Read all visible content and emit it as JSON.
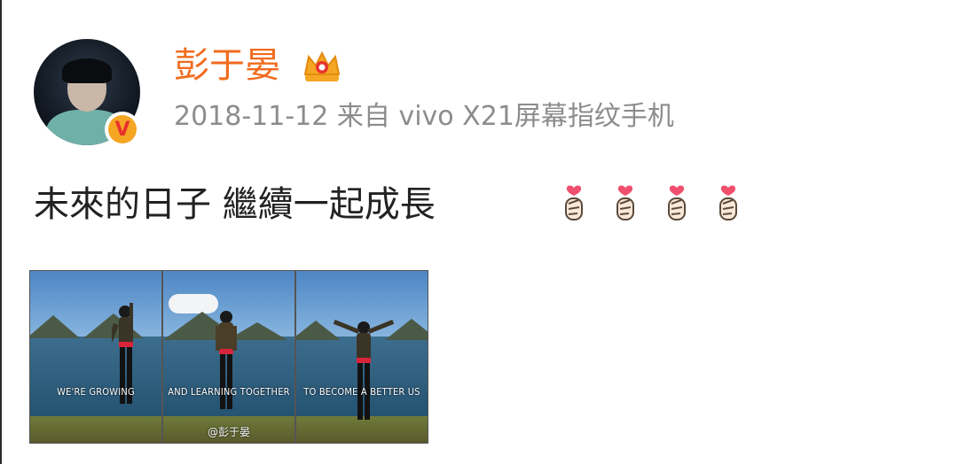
{
  "post": {
    "username": "彭于晏",
    "timestamp": "2018-11-12",
    "source_prefix": "来自",
    "device": "vivo X21屏幕指纹手机",
    "text": "未來的日子 繼續一起成長",
    "emoji_count": 4,
    "emoji_name": "finger-heart-emoji"
  },
  "badges": {
    "verified_mark": "V",
    "crown_icon": "crown-icon"
  },
  "gallery": {
    "images": [
      {
        "caption": "WE'RE GROWING"
      },
      {
        "caption": "AND LEARNING TOGETHER",
        "watermark": "@彭于晏"
      },
      {
        "caption": "TO BECOME A BETTER US"
      }
    ]
  },
  "colors": {
    "username": "#f26b1d",
    "meta": "#8c8c8c",
    "text": "#222222",
    "verified_bg": "#f5a623",
    "verified_fg": "#e8322e"
  }
}
